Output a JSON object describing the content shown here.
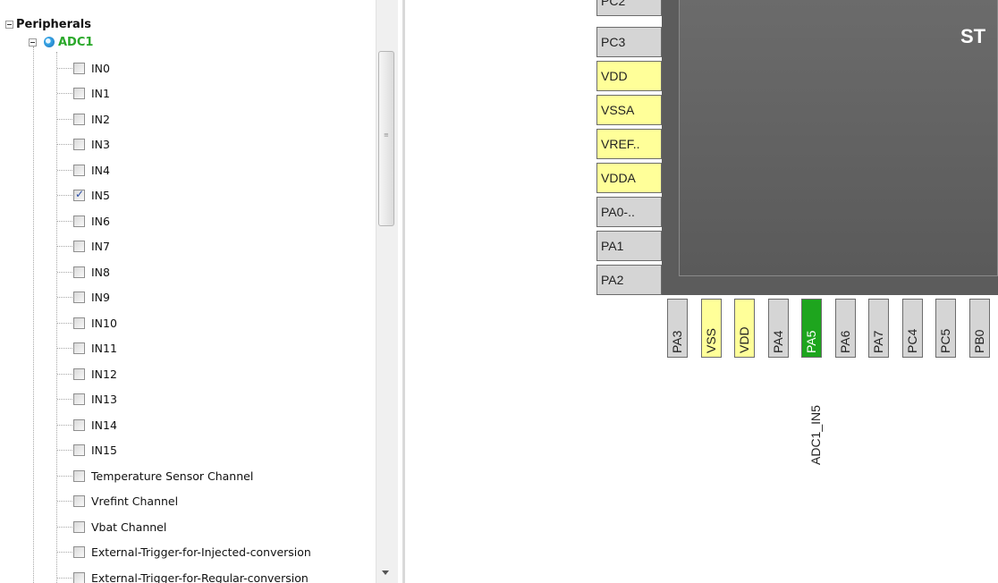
{
  "tree": {
    "root_label": "Peripherals",
    "adc_label": "ADC1",
    "items": [
      {
        "label": "IN0",
        "checked": false
      },
      {
        "label": "IN1",
        "checked": false
      },
      {
        "label": "IN2",
        "checked": false
      },
      {
        "label": "IN3",
        "checked": false
      },
      {
        "label": "IN4",
        "checked": false
      },
      {
        "label": "IN5",
        "checked": true
      },
      {
        "label": "IN6",
        "checked": false
      },
      {
        "label": "IN7",
        "checked": false
      },
      {
        "label": "IN8",
        "checked": false
      },
      {
        "label": "IN9",
        "checked": false
      },
      {
        "label": "IN10",
        "checked": false
      },
      {
        "label": "IN11",
        "checked": false
      },
      {
        "label": "IN12",
        "checked": false
      },
      {
        "label": "IN13",
        "checked": false
      },
      {
        "label": "IN14",
        "checked": false
      },
      {
        "label": "IN15",
        "checked": false
      },
      {
        "label": "Temperature Sensor Channel",
        "checked": false
      },
      {
        "label": "Vrefint Channel",
        "checked": false
      },
      {
        "label": "Vbat Channel",
        "checked": false
      },
      {
        "label": "External-Trigger-for-Injected-conversion",
        "checked": false
      },
      {
        "label": "External-Trigger-for-Regular-conversion",
        "checked": false
      }
    ]
  },
  "chip": {
    "label": "ST",
    "left_pins": [
      {
        "label": "PC2",
        "color": "gray"
      },
      {
        "label": "PC3",
        "color": "gray"
      },
      {
        "label": "VDD",
        "color": "yellow"
      },
      {
        "label": "VSSA",
        "color": "yellow"
      },
      {
        "label": "VREF..",
        "color": "yellow"
      },
      {
        "label": "VDDA",
        "color": "yellow"
      },
      {
        "label": "PA0-..",
        "color": "gray"
      },
      {
        "label": "PA1",
        "color": "gray"
      },
      {
        "label": "PA2",
        "color": "gray"
      }
    ],
    "bottom_pins": [
      {
        "label": "PA3",
        "color": "gray"
      },
      {
        "label": "VSS",
        "color": "yellow"
      },
      {
        "label": "VDD",
        "color": "yellow"
      },
      {
        "label": "PA4",
        "color": "gray"
      },
      {
        "label": "PA5",
        "color": "green"
      },
      {
        "label": "PA6",
        "color": "gray"
      },
      {
        "label": "PA7",
        "color": "gray"
      },
      {
        "label": "PC4",
        "color": "gray"
      },
      {
        "label": "PC5",
        "color": "gray"
      },
      {
        "label": "PB0",
        "color": "gray"
      }
    ],
    "signal_label": "ADC1_IN5"
  },
  "colors": {
    "gray": "#d5d5d5",
    "yellow": "#ffff99",
    "green": "#1ea51e"
  }
}
